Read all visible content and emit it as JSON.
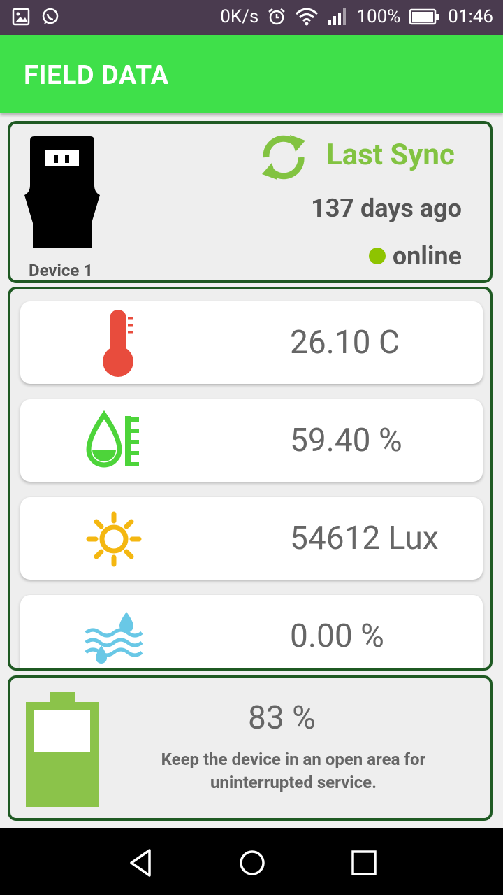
{
  "status_bar": {
    "speed": "0K/s",
    "battery": "100%",
    "time": "01:46"
  },
  "app_bar": {
    "title": "FIELD DATA"
  },
  "device": {
    "name": "Device 1",
    "sync_title": "Last Sync",
    "sync_time": "137 days ago",
    "status": "online",
    "status_color": "#8ec400"
  },
  "sensors": [
    {
      "icon": "thermometer-icon",
      "value": "26.10 C"
    },
    {
      "icon": "humidity-icon",
      "value": "59.40 %"
    },
    {
      "icon": "sun-icon",
      "value": "54612 Lux"
    },
    {
      "icon": "water-level-icon",
      "value": "0.00 %"
    }
  ],
  "battery": {
    "percent_label": "83 %",
    "level": 0.83,
    "message": "Keep the device in an open area for uninterrupted service."
  },
  "colors": {
    "app_bar": "#3fe04a",
    "card_border": "#1f5a23",
    "accent": "#82c341"
  }
}
